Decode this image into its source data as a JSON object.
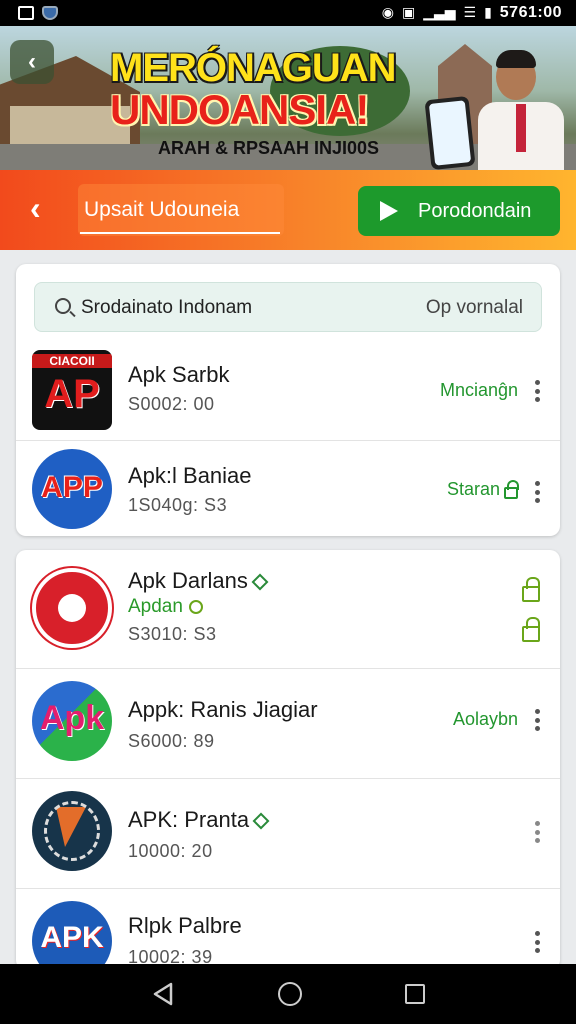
{
  "status_bar": {
    "time": "5761:00"
  },
  "banner": {
    "title_line1": "MERÓNAGUAN",
    "title_line2": "UNDOANSIA!",
    "subtitle": "ARAH & RPSAAH INJI00S"
  },
  "action_bar": {
    "field_text": "Upsait Udouneia",
    "cta_label": "Porodondain"
  },
  "search": {
    "query": "Srodainato Indonam",
    "filter_label": "Op vornalal"
  },
  "apps_card1": [
    {
      "name": "Apk Sarbk",
      "size": "S0002: 00",
      "action": "Mncianĝn",
      "icon_text": "AP",
      "icon_caption": "CIACOII"
    },
    {
      "name": "Apk:l Baniae",
      "size": "1S040g: S3",
      "action": "Staran",
      "icon_text": "APP"
    }
  ],
  "apps_card2": [
    {
      "name": "Apk Darlans",
      "sub": "Apdan",
      "size": "S3010: S3"
    },
    {
      "name": "Appk: Ranis Jiagiar",
      "size": "S6000: 89",
      "action": "Aolaybn",
      "icon_text": "Apk"
    },
    {
      "name": "APK: Pranta",
      "size": "10000: 20"
    },
    {
      "name": "Rlpk Palbre",
      "size": "10002: 39",
      "icon_text": "APK"
    }
  ],
  "colors": {
    "accent_orange": "#f24a1c",
    "accent_green": "#1d9a2c",
    "status_green": "#23962f"
  },
  "icons": [
    "back-icon",
    "play-icon",
    "search-icon",
    "lock-icon",
    "more-vert-icon",
    "nav-back-icon",
    "nav-home-icon",
    "nav-recents-icon"
  ]
}
